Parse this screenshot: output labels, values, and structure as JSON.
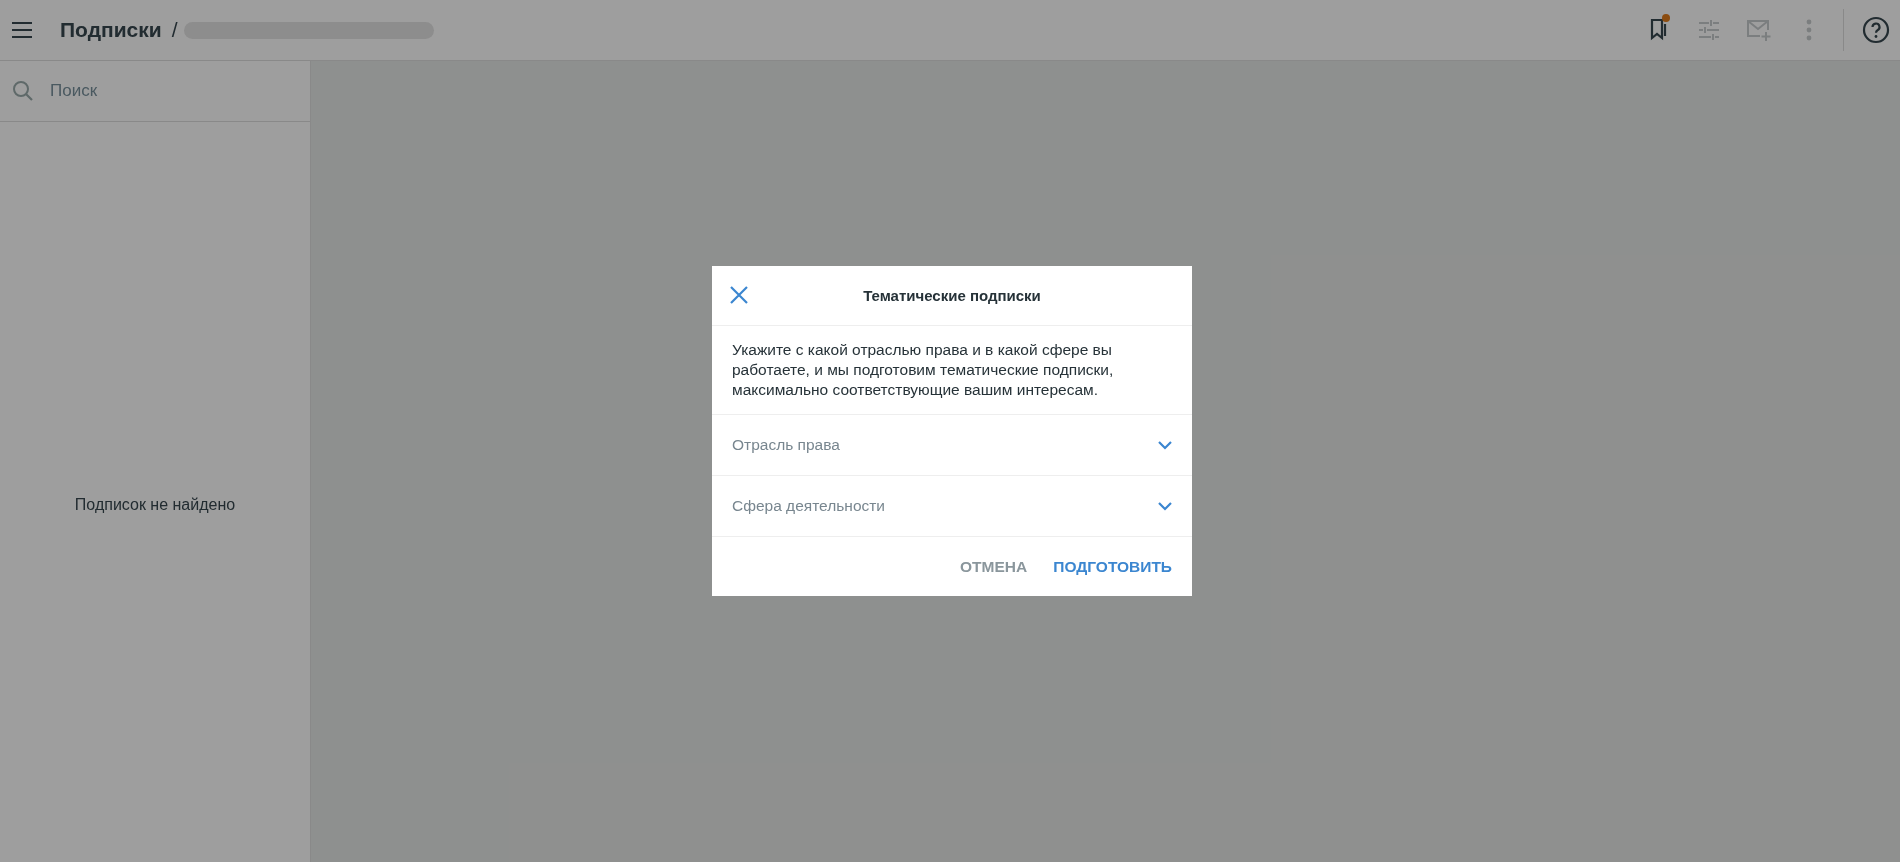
{
  "header": {
    "title": "Подписки",
    "separator": "/"
  },
  "toolbar": [
    {
      "kind": "bookmark",
      "disabled": false,
      "badge": true
    },
    {
      "kind": "sliders",
      "disabled": true
    },
    {
      "kind": "mail-add",
      "disabled": true
    },
    {
      "kind": "more",
      "disabled": true
    },
    {
      "kind": "help",
      "disabled": false
    }
  ],
  "sidebar": {
    "search": {
      "placeholder": "Поиск"
    },
    "empty_text": "Подписок не найдено"
  },
  "dialog": {
    "title": "Тематические подписки",
    "description": "Укажите с какой отраслью права и в какой сфере вы работаете, и мы подготовим тематические подписки, максимально соответствующие вашим интересам.",
    "selects": [
      {
        "placeholder": "Отрасль права"
      },
      {
        "placeholder": "Сфера деятельности"
      }
    ],
    "buttons": [
      {
        "label": "ОТМЕНА",
        "kind": "secondary"
      },
      {
        "label": "ПОДГОТОВИТЬ",
        "kind": "primary"
      }
    ]
  }
}
